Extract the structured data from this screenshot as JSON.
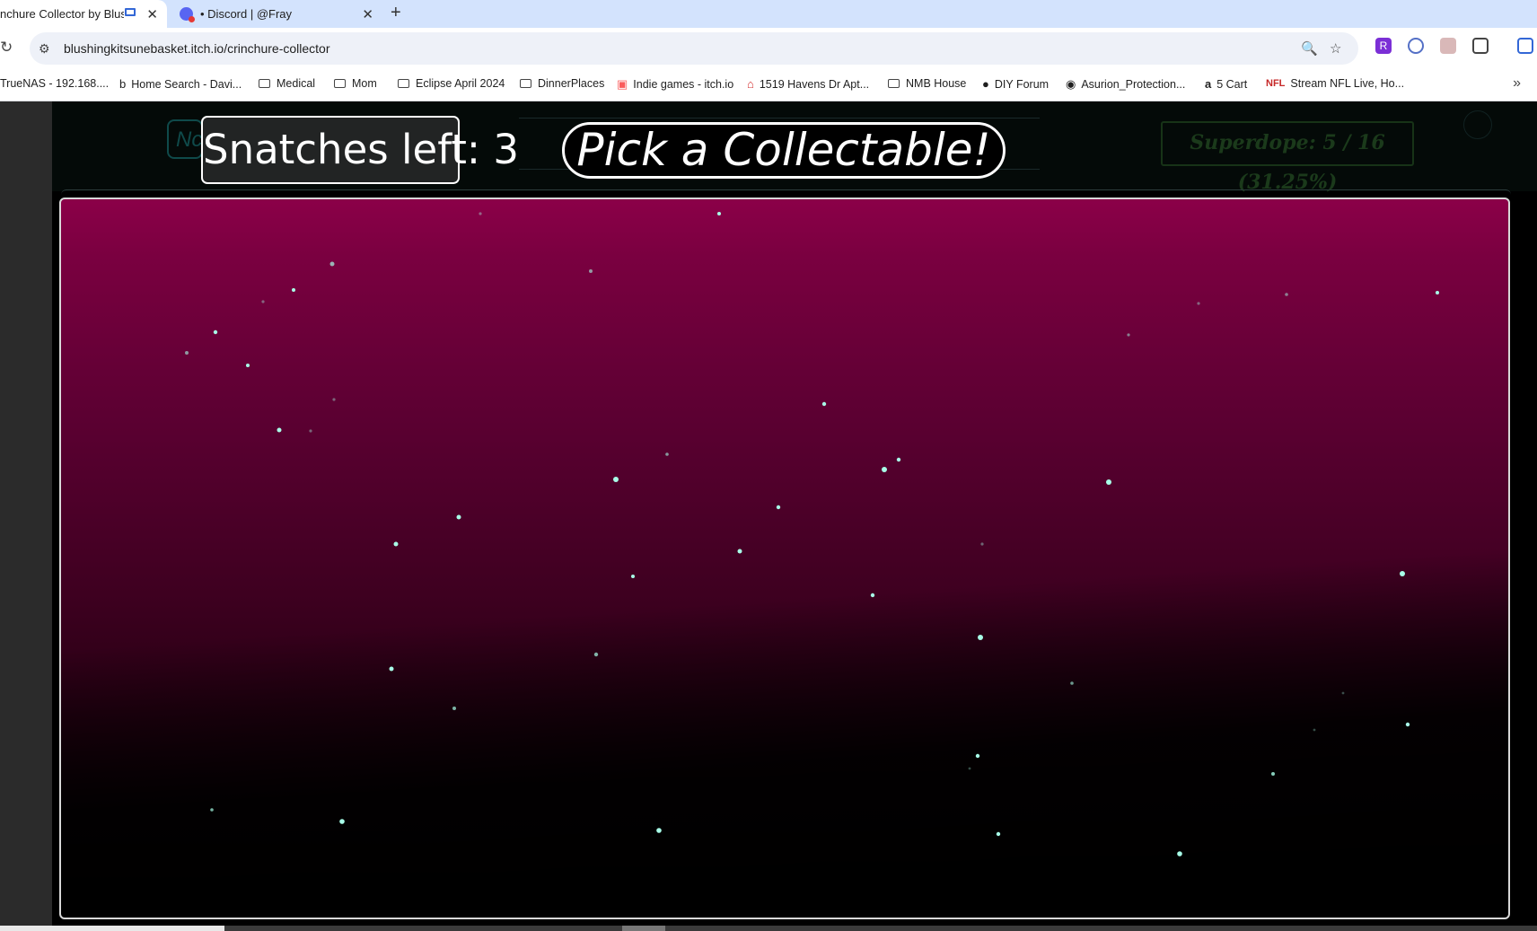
{
  "browser": {
    "tabs": [
      {
        "title": "nchure Collector by Blus",
        "active": true,
        "icon": "media-cast-icon"
      },
      {
        "title": "• Discord | @Fray",
        "active": false,
        "icon": "discord-icon"
      }
    ],
    "url": "blushingkitsunebasket.itch.io/crinchure-collector",
    "extensions": [
      "R"
    ],
    "bookmarks": [
      {
        "label": "TrueNAS - 192.168....",
        "icon": "none"
      },
      {
        "label": "Home Search - Davi...",
        "icon": "b-icon"
      },
      {
        "label": "Medical",
        "icon": "folder-icon"
      },
      {
        "label": "Mom",
        "icon": "folder-icon"
      },
      {
        "label": "Eclipse April 2024",
        "icon": "folder-icon"
      },
      {
        "label": "DinnerPlaces",
        "icon": "folder-icon"
      },
      {
        "label": "Indie games - itch.io",
        "icon": "itch-icon"
      },
      {
        "label": "1519 Havens Dr Apt...",
        "icon": "house-icon"
      },
      {
        "label": "NMB House",
        "icon": "folder-icon"
      },
      {
        "label": "DIY Forum",
        "icon": "diy-icon"
      },
      {
        "label": "Asurion_Protection...",
        "icon": "q-icon"
      },
      {
        "label": "5 Cart",
        "icon": "amazon-icon"
      },
      {
        "label": "Stream NFL Live, Ho...",
        "icon": "nfl-icon"
      }
    ]
  },
  "game": {
    "snatches_label": "Snatches left: 3",
    "prompt_label": "Pick a Collectable!",
    "ghost_left_text": "Nc",
    "ghost_right_text": "Superdope: 5 / 16 (31.25%)",
    "colors": {
      "accent_pink": "#8b0048",
      "sparkle": "#a8ffe8",
      "panel": "#222424"
    }
  }
}
